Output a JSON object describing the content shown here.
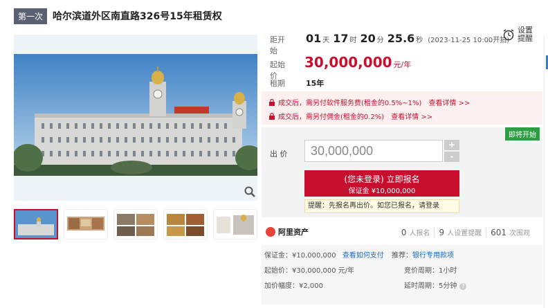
{
  "header": {
    "round_badge": "第一次",
    "title": "哈尔滨道外区南直路326号15年租赁权"
  },
  "countdown": {
    "label": "距开始",
    "days": "01",
    "days_unit": "天",
    "hours": "17",
    "hours_unit": "时",
    "minutes": "20",
    "minutes_unit": "分",
    "seconds": "25.6",
    "seconds_unit": "秒",
    "start_time": "(2023-11-25 10:00开拍)"
  },
  "settings": {
    "label": "设置提醒"
  },
  "start_price": {
    "label": "起始价",
    "value": "30,000,000",
    "unit": "元/年"
  },
  "lease": {
    "label": "租期",
    "value": "15年"
  },
  "notices": [
    {
      "text": "成交后，需另付软件服务费(租金的0.5%~1%)",
      "link": "查看详情 >>"
    },
    {
      "text": "成交后，需另付佣金(租金的0.2%)",
      "link": "查看详情 >>"
    }
  ],
  "bid": {
    "start_badge": "即将开始",
    "label": "出 价",
    "input_value": "30,000,000",
    "plus": "+",
    "minus": "-",
    "register_line1": "(您未登录) 立即报名",
    "register_line2": "保证金 ¥10,000,000",
    "hint": "提醒：先报名再出价。如您已报名，请登录"
  },
  "stats": {
    "brand": "阿里资产",
    "enrolled_count": "0",
    "enrolled_label": "人报名",
    "reminders_count": "9",
    "reminders_label": "人设置提醒",
    "views_count": "601",
    "views_label": "次围观"
  },
  "details": {
    "deposit": "保证金：¥10,000,000",
    "deposit_link": "查看如何支付",
    "recommend": "推荐：",
    "recommend_link": "银行专用款项",
    "start_price": "起始价：¥30,000,000 元/年",
    "bid_cycle": "竞价周期：1小时",
    "increment": "加价幅度：¥2,000",
    "delay_cycle": "延时周期：5分钟"
  },
  "colors": {
    "accent": "#c8102e",
    "badge_bg": "#5a6172",
    "start_badge": "#2e9e44",
    "link": "#1a6bc6"
  },
  "icons": {
    "zoom": "magnifier-icon",
    "clock": "alarm-clock-icon",
    "lock": "lock-icon",
    "brand": "ali-asset-logo-icon",
    "help": "question-icon"
  }
}
